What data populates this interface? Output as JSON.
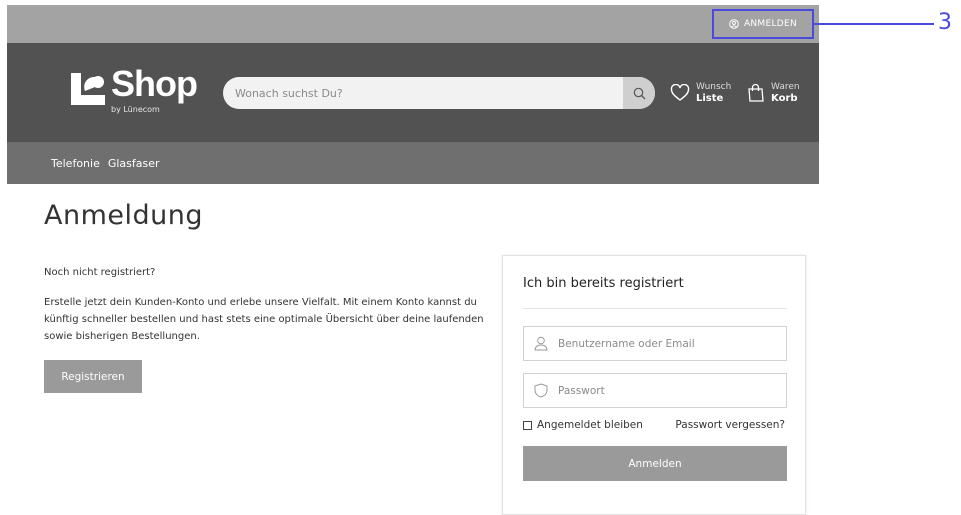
{
  "topbar": {
    "login_label": "ANMELDEN"
  },
  "callout": {
    "number": "3",
    "color": "#4a4adf"
  },
  "header": {
    "logo_word": "Shop",
    "logo_sub": "by Lünecom",
    "search_placeholder": "Wonach suchst Du?",
    "wishlist": {
      "line1": "Wunsch",
      "line2": "Liste"
    },
    "cart": {
      "line1": "Waren",
      "line2": "Korb"
    }
  },
  "nav": {
    "items": [
      "Telefonie",
      "Glasfaser"
    ]
  },
  "main": {
    "title": "Anmeldung",
    "register": {
      "heading": "Noch nicht registriert?",
      "text": "Erstelle jetzt dein Kunden-Konto und erlebe unsere Vielfalt. Mit einem Konto kannst du künftig schneller bestellen und hast stets eine optimale Übersicht über deine laufenden sowie bisherigen Bestellungen.",
      "button": "Registrieren"
    },
    "login": {
      "title": "Ich bin bereits registriert",
      "username_placeholder": "Benutzername oder Email",
      "password_placeholder": "Passwort",
      "remember_label": "Angemeldet bleiben",
      "forgot_label": "Passwort vergessen?",
      "button": "Anmelden"
    }
  },
  "icons": {
    "login": "user-circle-icon",
    "search": "search-icon",
    "wishlist": "heart-icon",
    "cart": "shopping-bag-icon",
    "username": "user-icon",
    "password": "shield-icon"
  },
  "colors": {
    "topbar": "#a3a3a3",
    "header": "#525252",
    "nav": "#6f6f6f",
    "button": "#9a9a9a",
    "highlight": "#4a4adf"
  }
}
